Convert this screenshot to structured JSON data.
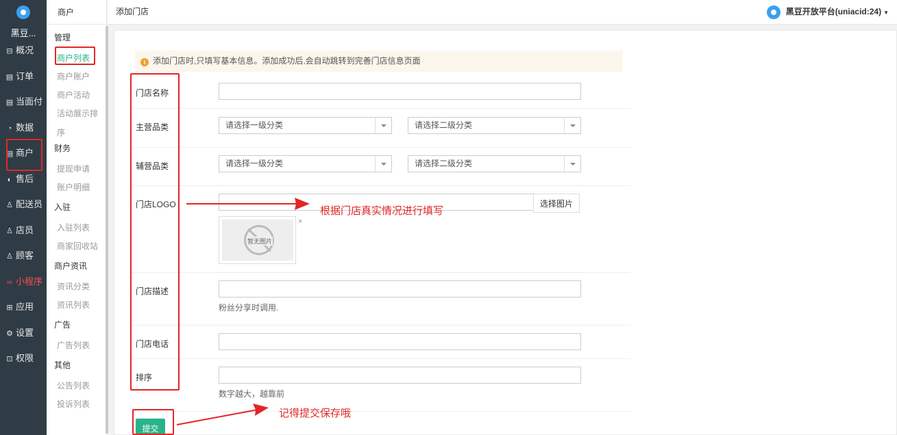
{
  "brand": {
    "name": "黑豆..."
  },
  "main_nav": [
    {
      "label": "概况",
      "icon": "overview-icon",
      "glyph": "⊟"
    },
    {
      "label": "订单",
      "icon": "order-icon",
      "glyph": "▤"
    },
    {
      "label": "当面付",
      "icon": "pay-icon",
      "glyph": "▤"
    },
    {
      "label": "数据",
      "icon": "data-icon",
      "glyph": "◔"
    },
    {
      "label": "商户",
      "icon": "merchant-icon",
      "glyph": "▤"
    },
    {
      "label": "售后",
      "icon": "aftersale-icon",
      "glyph": "◐"
    },
    {
      "label": "配送员",
      "icon": "courier-icon",
      "glyph": "♙"
    },
    {
      "label": "店员",
      "icon": "clerk-icon",
      "glyph": "♙"
    },
    {
      "label": "顾客",
      "icon": "customer-icon",
      "glyph": "♙"
    },
    {
      "label": "小程序",
      "icon": "miniprogram-icon",
      "glyph": "∞"
    },
    {
      "label": "应用",
      "icon": "apps-icon",
      "glyph": "⊞"
    },
    {
      "label": "设置",
      "icon": "settings-icon",
      "glyph": "⚙"
    },
    {
      "label": "权限",
      "icon": "lock-icon",
      "glyph": "⊡"
    }
  ],
  "sub_nav": {
    "header": "商户",
    "groups": {
      "manage": "管理",
      "finance": "财务",
      "join": "入驻",
      "news": "商户资讯",
      "ads": "广告",
      "other": "其他"
    },
    "links": {
      "merchant_list": "商户列表",
      "merchant_account": "商户账户",
      "merchant_activity": "商户活动",
      "activity_display_1": "活动展示排",
      "activity_display_2": "序",
      "withdraw": "提现申请",
      "account_detail": "账户明细",
      "join_list": "入驻列表",
      "recycle": "商家回收站",
      "news_category": "资讯分类",
      "news_list": "资讯列表",
      "ad_list": "广告列表",
      "notice_list": "公告列表",
      "complaint_list": "投诉列表"
    }
  },
  "topbar": {
    "title": "添加门店",
    "user": "黑豆开放平台(uniacid:24)"
  },
  "form": {
    "notice": "添加门店时,只填写基本信息。添加成功后,会自动跳转到完善门店信息页面",
    "labels": {
      "name": "门店名称",
      "main_category": "主营品类",
      "sub_category": "辅营品类",
      "logo": "门店LOGO",
      "desc": "门店描述",
      "phone": "门店电话",
      "sort": "排序"
    },
    "select_first": "请选择一级分类",
    "select_second": "请选择二级分类",
    "pick_image": "选择图片",
    "no_image": "暂无图片",
    "close": "×",
    "desc_help": "粉丝分享时调用.",
    "sort_help": "数字越大，越靠前",
    "submit": "提交"
  },
  "annotations": {
    "fill_hint": "根据门店真实情况进行填写",
    "submit_hint": "记得提交保存哦"
  },
  "colors": {
    "sidebar": "#2f3c46",
    "accent": "#28b48b",
    "annotation": "#e32626",
    "notice_bg": "#fdf6ec"
  }
}
